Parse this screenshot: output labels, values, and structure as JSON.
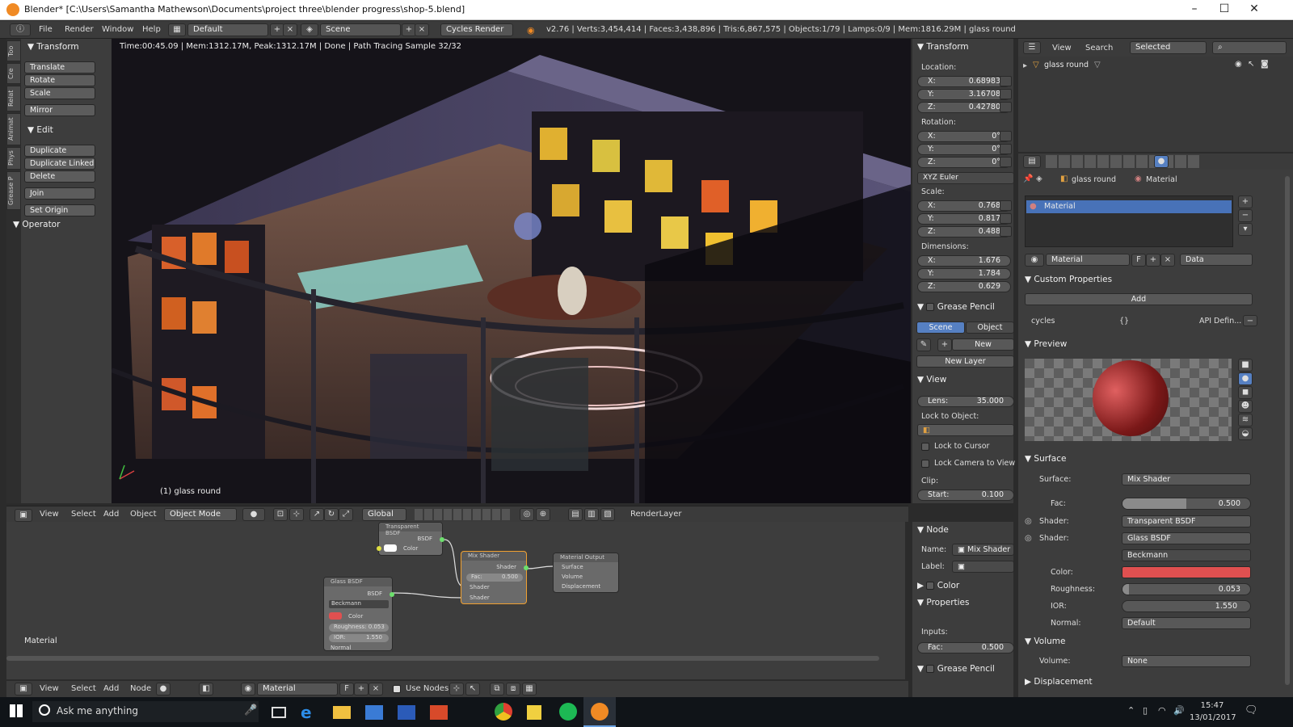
{
  "window": {
    "title": "Blender* [C:\\Users\\Samantha Mathewson\\Documents\\project three\\blender progress\\shop-5.blend]",
    "controls": [
      "–",
      "☐",
      "✕"
    ]
  },
  "infobar": {
    "menus": [
      "File",
      "Render",
      "Window",
      "Help"
    ],
    "layout": "Default",
    "scene": "Scene",
    "engine": "Cycles Render",
    "stats": "v2.76 | Verts:3,454,414 | Faces:3,438,896 | Tris:6,867,575 | Objects:1/79 | Lamps:0/9 | Mem:1816.29M | glass round"
  },
  "tool_tabs": [
    "Too",
    "Cre",
    "Relat",
    "Animat",
    "Phys",
    "Grease P"
  ],
  "tools": {
    "transform_header": "Transform",
    "transform": [
      "Translate",
      "Rotate",
      "Scale",
      "Mirror"
    ],
    "edit_header": "Edit",
    "edit": [
      "Duplicate",
      "Duplicate Linked",
      "Delete",
      "Join",
      "Set Origin"
    ],
    "operator_header": "Operator"
  },
  "viewport": {
    "render_info": "Time:00:45.09 | Mem:1312.17M, Peak:1312.17M | Done | Path Tracing Sample 32/32",
    "active_object": "(1) glass round"
  },
  "npanel": {
    "transform_header": "Transform",
    "location_label": "Location:",
    "location": [
      {
        "k": "X:",
        "v": "0.68983"
      },
      {
        "k": "Y:",
        "v": "3.16708"
      },
      {
        "k": "Z:",
        "v": "0.42780"
      }
    ],
    "rotation_label": "Rotation:",
    "rotation": [
      {
        "k": "X:",
        "v": "0°"
      },
      {
        "k": "Y:",
        "v": "0°"
      },
      {
        "k": "Z:",
        "v": "0°"
      }
    ],
    "rotation_mode": "XYZ Euler",
    "scale_label": "Scale:",
    "scale": [
      {
        "k": "X:",
        "v": "0.768"
      },
      {
        "k": "Y:",
        "v": "0.817"
      },
      {
        "k": "Z:",
        "v": "0.488"
      }
    ],
    "dimensions_label": "Dimensions:",
    "dimensions": [
      {
        "k": "X:",
        "v": "1.676"
      },
      {
        "k": "Y:",
        "v": "1.784"
      },
      {
        "k": "Z:",
        "v": "0.629"
      }
    ],
    "grease_pencil": "Grease Pencil",
    "gp_scene": "Scene",
    "gp_object": "Object",
    "gp_new": "New",
    "gp_new_layer": "New Layer",
    "view_header": "View",
    "lens_label": "Lens:",
    "lens": "35.000",
    "lock_to_object": "Lock to Object:",
    "lock_to_cursor": "Lock to Cursor",
    "lock_camera": "Lock Camera to View",
    "clip_label": "Clip:",
    "clip_start_label": "Start:",
    "clip_start": "0.100"
  },
  "vpheader": {
    "menus": [
      "View",
      "Select",
      "Add",
      "Object"
    ],
    "mode": "Object Mode",
    "orientation": "Global",
    "render_layer": "RenderLayer"
  },
  "node_editor": {
    "material_label": "Material",
    "transparent": {
      "title": "Transparent BSDF",
      "out": "BSDF",
      "in": "Color"
    },
    "glass": {
      "title": "Glass BSDF",
      "out": "BSDF",
      "dist": "Beckmann",
      "color": "Color",
      "roughness": "Roughness: 0.053",
      "ior": "IOR:",
      "ior_val": "1.550",
      "normal": "Normal"
    },
    "mix": {
      "title": "Mix Shader",
      "out": "Shader",
      "fac": "Fac:",
      "fac_val": "0.500",
      "in1": "Shader",
      "in2": "Shader"
    },
    "output": {
      "title": "Material Output",
      "surface": "Surface",
      "volume": "Volume",
      "displacement": "Displacement"
    },
    "glass_color": "#e05050",
    "transparent_color": "#ffffff"
  },
  "node_header": {
    "menus": [
      "View",
      "Select",
      "Add",
      "Node"
    ],
    "material": "Material",
    "fake_user": "F",
    "use_nodes": "Use Nodes"
  },
  "node_panel": {
    "node_header": "Node",
    "name_label": "Name:",
    "name": "Mix Shader",
    "label_label": "Label:",
    "color_header": "Color",
    "properties_header": "Properties",
    "inputs_label": "Inputs:",
    "fac_label": "Fac:",
    "fac": "0.500",
    "grease_pencil": "Grease Pencil"
  },
  "outliner": {
    "menus": [
      "View",
      "Search"
    ],
    "filter": "Selected",
    "item": "glass round"
  },
  "properties": {
    "breadcrumb_object": "glass round",
    "breadcrumb_material": "Material",
    "slot": "Material",
    "material_name": "Material",
    "fake_user": "F",
    "link": "Data",
    "custom_props_header": "Custom Properties",
    "add": "Add",
    "cycles": "cycles",
    "cycles_val": "{}",
    "api": "API Defin...",
    "preview_header": "Preview",
    "surface_header": "Surface",
    "surface_label": "Surface:",
    "surface": "Mix Shader",
    "fac_label": "Fac:",
    "fac": "0.500",
    "fac_value": 0.5,
    "shader_label": "Shader:",
    "shader1": "Transparent BSDF",
    "shader2": "Glass BSDF",
    "distribution": "Beckmann",
    "color_label": "Color:",
    "color": "#e05050",
    "roughness_label": "Roughness:",
    "roughness": "0.053",
    "roughness_value": 0.053,
    "ior_label": "IOR:",
    "ior": "1.550",
    "normal_label": "Normal:",
    "normal": "Default",
    "volume_header": "Volume",
    "volume_label": "Volume:",
    "volume": "None",
    "displacement_header": "Displacement"
  },
  "taskbar": {
    "search": "Ask me anything",
    "time": "15:47",
    "date": "13/01/2017"
  }
}
